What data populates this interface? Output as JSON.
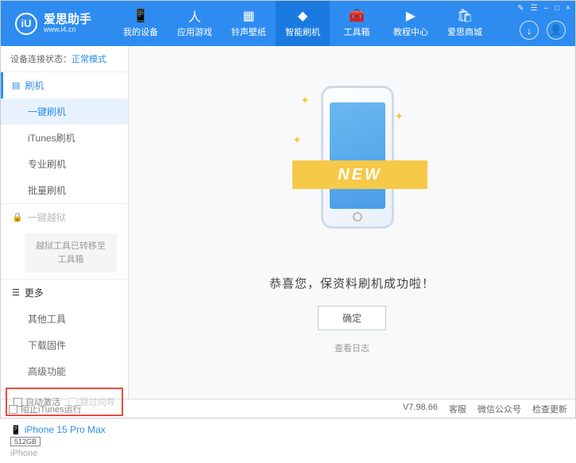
{
  "header": {
    "logo_letter": "iU",
    "title": "爱思助手",
    "subtitle": "www.i4.cn",
    "nav": [
      {
        "label": "我的设备"
      },
      {
        "label": "应用游戏"
      },
      {
        "label": "铃声壁纸"
      },
      {
        "label": "智能刷机"
      },
      {
        "label": "工具箱"
      },
      {
        "label": "教程中心"
      },
      {
        "label": "爱思商城"
      }
    ],
    "controls": {
      "minimize": "–",
      "maximize": "□",
      "close": "×",
      "menu": "☰",
      "skin": "✎"
    },
    "circles": {
      "download": "↓",
      "user": "👤"
    }
  },
  "sidebar": {
    "status_label": "设备连接状态：",
    "status_value": "正常模式",
    "section1": {
      "title": "刷机",
      "items": [
        "一键刷机",
        "iTunes刷机",
        "专业刷机",
        "批量刷机"
      ]
    },
    "jailbreak": {
      "title": "一键越狱",
      "note": "越狱工具已转移至\n工具箱"
    },
    "section2": {
      "title": "更多",
      "items": [
        "其他工具",
        "下载固件",
        "高级功能"
      ]
    },
    "checks": {
      "auto_activate": "自动激活",
      "skip_guide": "跳过向导"
    },
    "device": {
      "name": "iPhone 15 Pro Max",
      "storage": "512GB",
      "type": "iPhone"
    }
  },
  "main": {
    "ribbon": "NEW",
    "success": "恭喜您，保资料刷机成功啦！",
    "ok": "确定",
    "log": "查看日志"
  },
  "footer": {
    "block_itunes": "阻止iTunes运行",
    "version": "V7.98.66",
    "links": [
      "客服",
      "微信公众号",
      "检查更新"
    ]
  }
}
